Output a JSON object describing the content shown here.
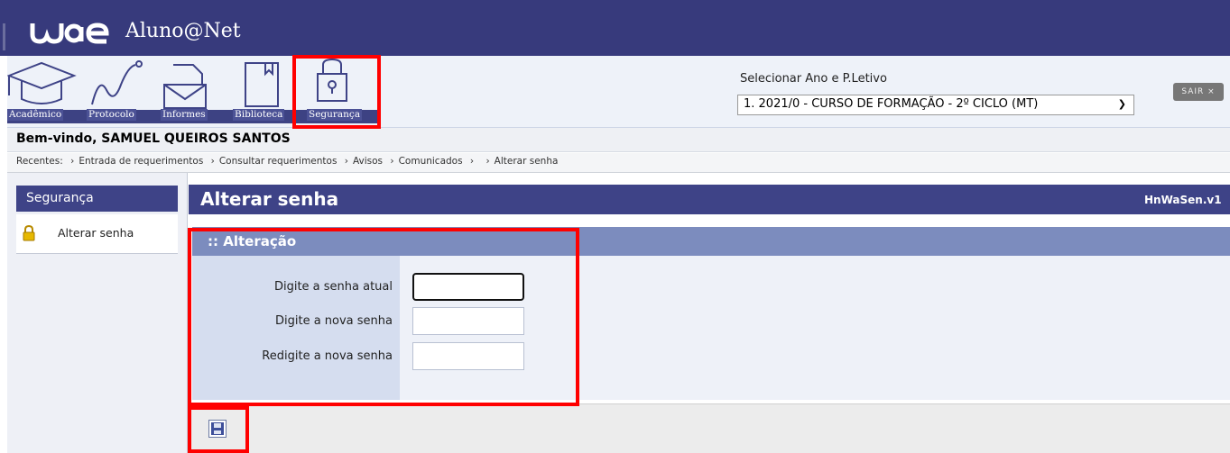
{
  "header": {
    "logo": "uae",
    "app_title": "Aluno@Net"
  },
  "toolbar": {
    "items": [
      {
        "label": "Acadêmico",
        "icon": "graduation-cap-icon"
      },
      {
        "label": "Protocolo",
        "icon": "zigzag-line-icon"
      },
      {
        "label": "Informes",
        "icon": "mail-icon"
      },
      {
        "label": "Biblioteca",
        "icon": "book-icon"
      },
      {
        "label": "Segurança",
        "icon": "padlock-icon"
      }
    ]
  },
  "period": {
    "label": "Selecionar Ano e P.Letivo",
    "selected": "1. 2021/0 - CURSO DE FORMAÇÃO - 2º CICLO (MT)"
  },
  "logout_label": "SAIR ×",
  "welcome": "Bem-vindo, SAMUEL QUEIROS SANTOS",
  "recent": {
    "label": "Recentes:",
    "items": [
      "Entrada de requerimentos",
      "Consultar requerimentos",
      "Avisos",
      "Comunicados",
      "",
      "Alterar senha"
    ]
  },
  "sidebar": {
    "title": "Segurança",
    "items": [
      {
        "label": "Alterar senha",
        "icon": "lock-icon"
      }
    ]
  },
  "main": {
    "title": "Alterar senha",
    "code": "HnWaSen.v1",
    "section": ":: Alteração",
    "fields": [
      {
        "label": "Digite a senha atual",
        "value": ""
      },
      {
        "label": "Digite a nova senha",
        "value": ""
      },
      {
        "label": "Redigite a nova senha",
        "value": ""
      }
    ],
    "save_icon": "floppy-disk-icon"
  },
  "colors": {
    "header": "#373a7c",
    "panel_head": "#3e4387",
    "section_head": "#7c8cbe",
    "highlight": "#ff0000"
  }
}
